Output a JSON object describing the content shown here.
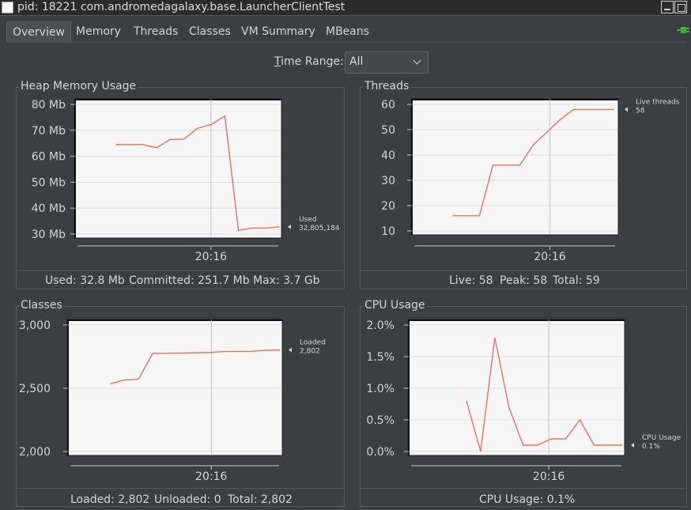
{
  "window": {
    "title": "pid: 18221 com.andromedagalaxy.base.LauncherClientTest"
  },
  "tabs": [
    {
      "label": "Overview",
      "active": true
    },
    {
      "label": "Memory"
    },
    {
      "label": "Threads"
    },
    {
      "label": "Classes"
    },
    {
      "label": "VM Summary"
    },
    {
      "label": "MBeans"
    }
  ],
  "time_range": {
    "label_prefix": "T",
    "label_rest": "ime Range:",
    "value": "All"
  },
  "colors": {
    "line": "#e8735a",
    "plot_bg": "#f6f6f6",
    "connect_icon": "#3db33d"
  },
  "panels": {
    "heap": {
      "title": "Heap Memory Usage",
      "summary_used": "Used: 32.8 Mb",
      "summary_committed": "Committed: 251.7 Mb",
      "summary_max": "Max: 3.7 Gb",
      "legend_name": "Used",
      "legend_value": "32,805,184"
    },
    "threads": {
      "title": "Threads",
      "summary_live": "Live: 58",
      "summary_peak": "Peak: 58",
      "summary_total": "Total: 59",
      "legend_name": "Live threads",
      "legend_value": "58"
    },
    "classes": {
      "title": "Classes",
      "summary_loaded": "Loaded: 2,802",
      "summary_unloaded": "Unloaded: 0",
      "summary_total": "Total: 2,802",
      "legend_name": "Loaded",
      "legend_value": "2,802"
    },
    "cpu": {
      "title": "CPU Usage",
      "summary_usage": "CPU Usage: 0.1%",
      "legend_name": "CPU Usage",
      "legend_value": "0.1%"
    }
  },
  "chart_data": [
    {
      "id": "heap",
      "type": "line",
      "title": "Heap Memory Usage",
      "yticks": [
        "30 Mb",
        "40 Mb",
        "50 Mb",
        "60 Mb",
        "70 Mb",
        "80 Mb"
      ],
      "ylim": [
        30,
        80
      ],
      "xticks": [
        "20:16"
      ],
      "series": [
        {
          "name": "Used",
          "values": [
            64.5,
            64.5,
            64.5,
            63.3,
            66.5,
            66.6,
            70.8,
            72.2,
            75.5,
            31.4,
            32.3,
            32.3,
            32.8
          ]
        }
      ]
    },
    {
      "id": "threads",
      "type": "line",
      "title": "Threads",
      "yticks": [
        "10",
        "20",
        "30",
        "40",
        "50",
        "60"
      ],
      "ylim": [
        10,
        60
      ],
      "xticks": [
        "20:16"
      ],
      "series": [
        {
          "name": "Live threads",
          "values": [
            16,
            16,
            16,
            36,
            36,
            36,
            44,
            49,
            54,
            58,
            58,
            58,
            58
          ]
        }
      ]
    },
    {
      "id": "classes",
      "type": "line",
      "title": "Classes",
      "yticks": [
        "2,000",
        "2,500",
        "3,000"
      ],
      "ylim": [
        2000,
        3000
      ],
      "xticks": [
        "20:16"
      ],
      "series": [
        {
          "name": "Loaded",
          "values": [
            2535,
            2565,
            2572,
            2775,
            2776,
            2778,
            2780,
            2782,
            2790,
            2791,
            2792,
            2800,
            2802
          ]
        }
      ]
    },
    {
      "id": "cpu",
      "type": "line",
      "title": "CPU Usage",
      "yticks": [
        "0.0%",
        "0.5%",
        "1.0%",
        "1.5%",
        "2.0%"
      ],
      "ylim": [
        0,
        2
      ],
      "xticks": [
        "20:16"
      ],
      "series": [
        {
          "name": "CPU Usage",
          "values": [
            0.8,
            0.0,
            1.8,
            0.7,
            0.1,
            0.1,
            0.2,
            0.2,
            0.5,
            0.1,
            0.1,
            0.1
          ]
        }
      ]
    }
  ]
}
